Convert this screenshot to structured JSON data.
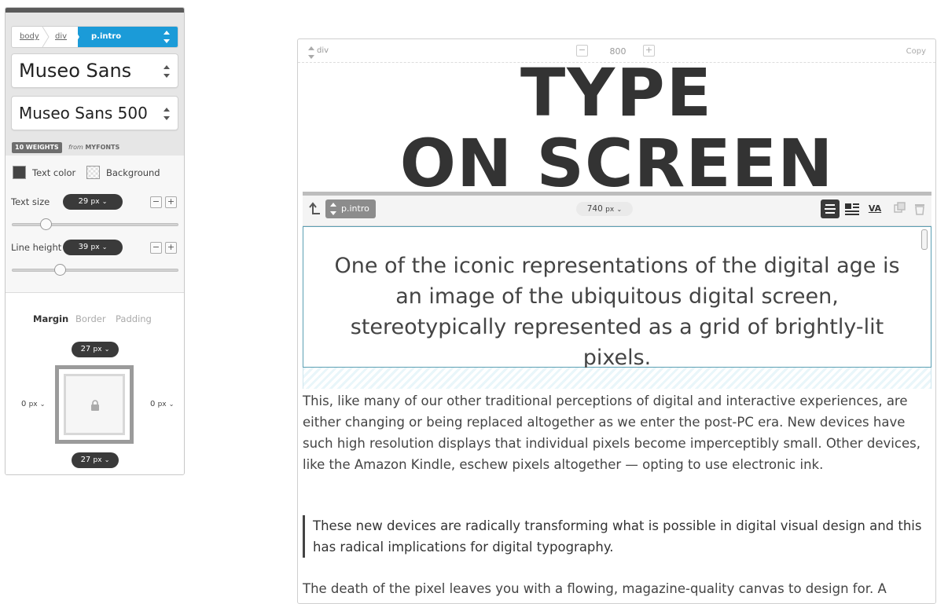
{
  "breadcrumb": {
    "items": [
      "body",
      "div"
    ],
    "active": "p.intro"
  },
  "font": {
    "family": "Museo Sans",
    "weight": "Museo Sans 500",
    "weights_badge": "10 WEIGHTS",
    "from_prefix": "from",
    "from_source": "MYFONTS"
  },
  "colors": {
    "text_color_label": "Text color",
    "background_label": "Background",
    "accent": "#1b9bd8"
  },
  "text_size": {
    "label": "Text size",
    "value": "29",
    "unit": "px",
    "slider_fraction": 0.2
  },
  "line_height": {
    "label": "Line height",
    "value": "39",
    "unit": "px",
    "slider_fraction": 0.3
  },
  "box_model": {
    "tabs": [
      "Margin",
      "Border",
      "Padding"
    ],
    "active_tab": "Margin",
    "top": "27",
    "bottom": "27",
    "left": "0",
    "right": "0",
    "unit": "px"
  },
  "preview_header": {
    "element": "div",
    "minus": "−",
    "plus": "+",
    "width": "800",
    "copy": "Copy"
  },
  "headline": {
    "line1": "TYPE",
    "line2": "ON SCREEN"
  },
  "element_toolbar": {
    "tag": "p.intro",
    "width": "740",
    "unit": "px",
    "va_label": "VA"
  },
  "content": {
    "intro": "One of the iconic representations of the digital age is an image of the ubiquitous digital screen, stereotypically represented as a grid of brightly-lit pixels.",
    "paragraph": "This, like many of our other traditional perceptions of digital and interactive experiences, are either changing or being replaced altogether as we enter the post-PC era. New devices have such high resolution displays that individual pixels become imperceptibly small. Other devices, like the Amazon Kindle, eschew pixels altogether — opting to use electronic ink.",
    "quote": "These new devices are radically transforming what is possible in digital visual design and this has radical implications for digital typography.",
    "tail": "The death of the pixel leaves you with a flowing, magazine-quality canvas to design for. A"
  }
}
